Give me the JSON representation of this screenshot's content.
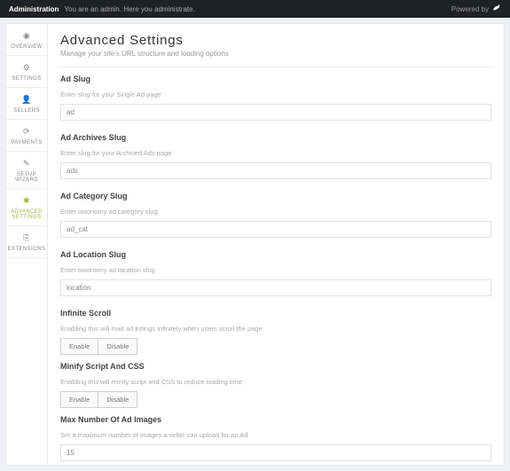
{
  "topbar": {
    "title": "Administration",
    "subtitle": "You are an admin. Here you administrate.",
    "powered": "Powered by"
  },
  "sidebar": {
    "items": [
      {
        "label": "OVERVIEW",
        "icon": "◉"
      },
      {
        "label": "SETTINGS",
        "icon": "⚙"
      },
      {
        "label": "SELLERS",
        "icon": "👤"
      },
      {
        "label": "PAYMENTS",
        "icon": "⟳"
      },
      {
        "label": "SETUP WIZARD",
        "icon": "✎"
      },
      {
        "label": "ADVANCED SETTINGS",
        "icon": "✱"
      },
      {
        "label": "EXTENSIONS",
        "icon": "⎘"
      }
    ]
  },
  "page": {
    "title": "Advanced Settings",
    "subtitle": "Manage your site's URL structure and loading options"
  },
  "sections": {
    "ad_slug": {
      "label": "Ad Slug",
      "hint": "Enter slug for your Single Ad page",
      "value": "ad"
    },
    "archives": {
      "label": "Ad Archives Slug",
      "hint": "Enter slug for your Archived Ads page",
      "value": "ads"
    },
    "category": {
      "label": "Ad Category Slug",
      "hint": "Enter taxonomy ad category slug",
      "value": "ad_cat"
    },
    "location": {
      "label": "Ad Location Slug",
      "hint": "Enter taxonomy ad location slug",
      "value": "location"
    },
    "scroll": {
      "label": "Infinite Scroll",
      "hint": "Enabling this will load ad listings infinitely when users scroll the page"
    },
    "minify": {
      "label": "Minify Script And CSS",
      "hint": "Enabling this will minify script and CSS to reduce loading time"
    },
    "maximg": {
      "label": "Max Number Of Ad Images",
      "hint": "Set a maximum number of images a seller can upload for an Ad",
      "value": "15"
    }
  },
  "buttons": {
    "enable": "Enable",
    "disable": "Disable"
  }
}
